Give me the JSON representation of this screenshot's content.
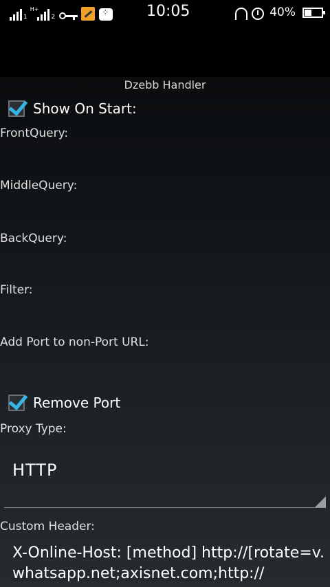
{
  "status_bar": {
    "time": "10:05",
    "sim1_label": "1",
    "sim2_label": "2",
    "network_type": "H+",
    "battery_percent": "40%",
    "battery_level": 0.4
  },
  "dialog": {
    "title": "Dzebb Handler",
    "show_on_start_label": "Show On Start:",
    "show_on_start_checked": true,
    "front_query_label": "FrontQuery:",
    "middle_query_label": "MiddleQuery:",
    "back_query_label": "BackQuery:",
    "filter_label": "Filter:",
    "add_port_label": "Add Port to non-Port URL:",
    "remove_port_label": "Remove Port",
    "remove_port_checked": true,
    "proxy_type_label": "Proxy Type:",
    "proxy_type_value": "HTTP",
    "custom_header_label": "Custom Header:",
    "custom_header_value": "X-Online-Host: [method] http://[rotate=v.whatsapp.net;axisnet.com;http://"
  }
}
